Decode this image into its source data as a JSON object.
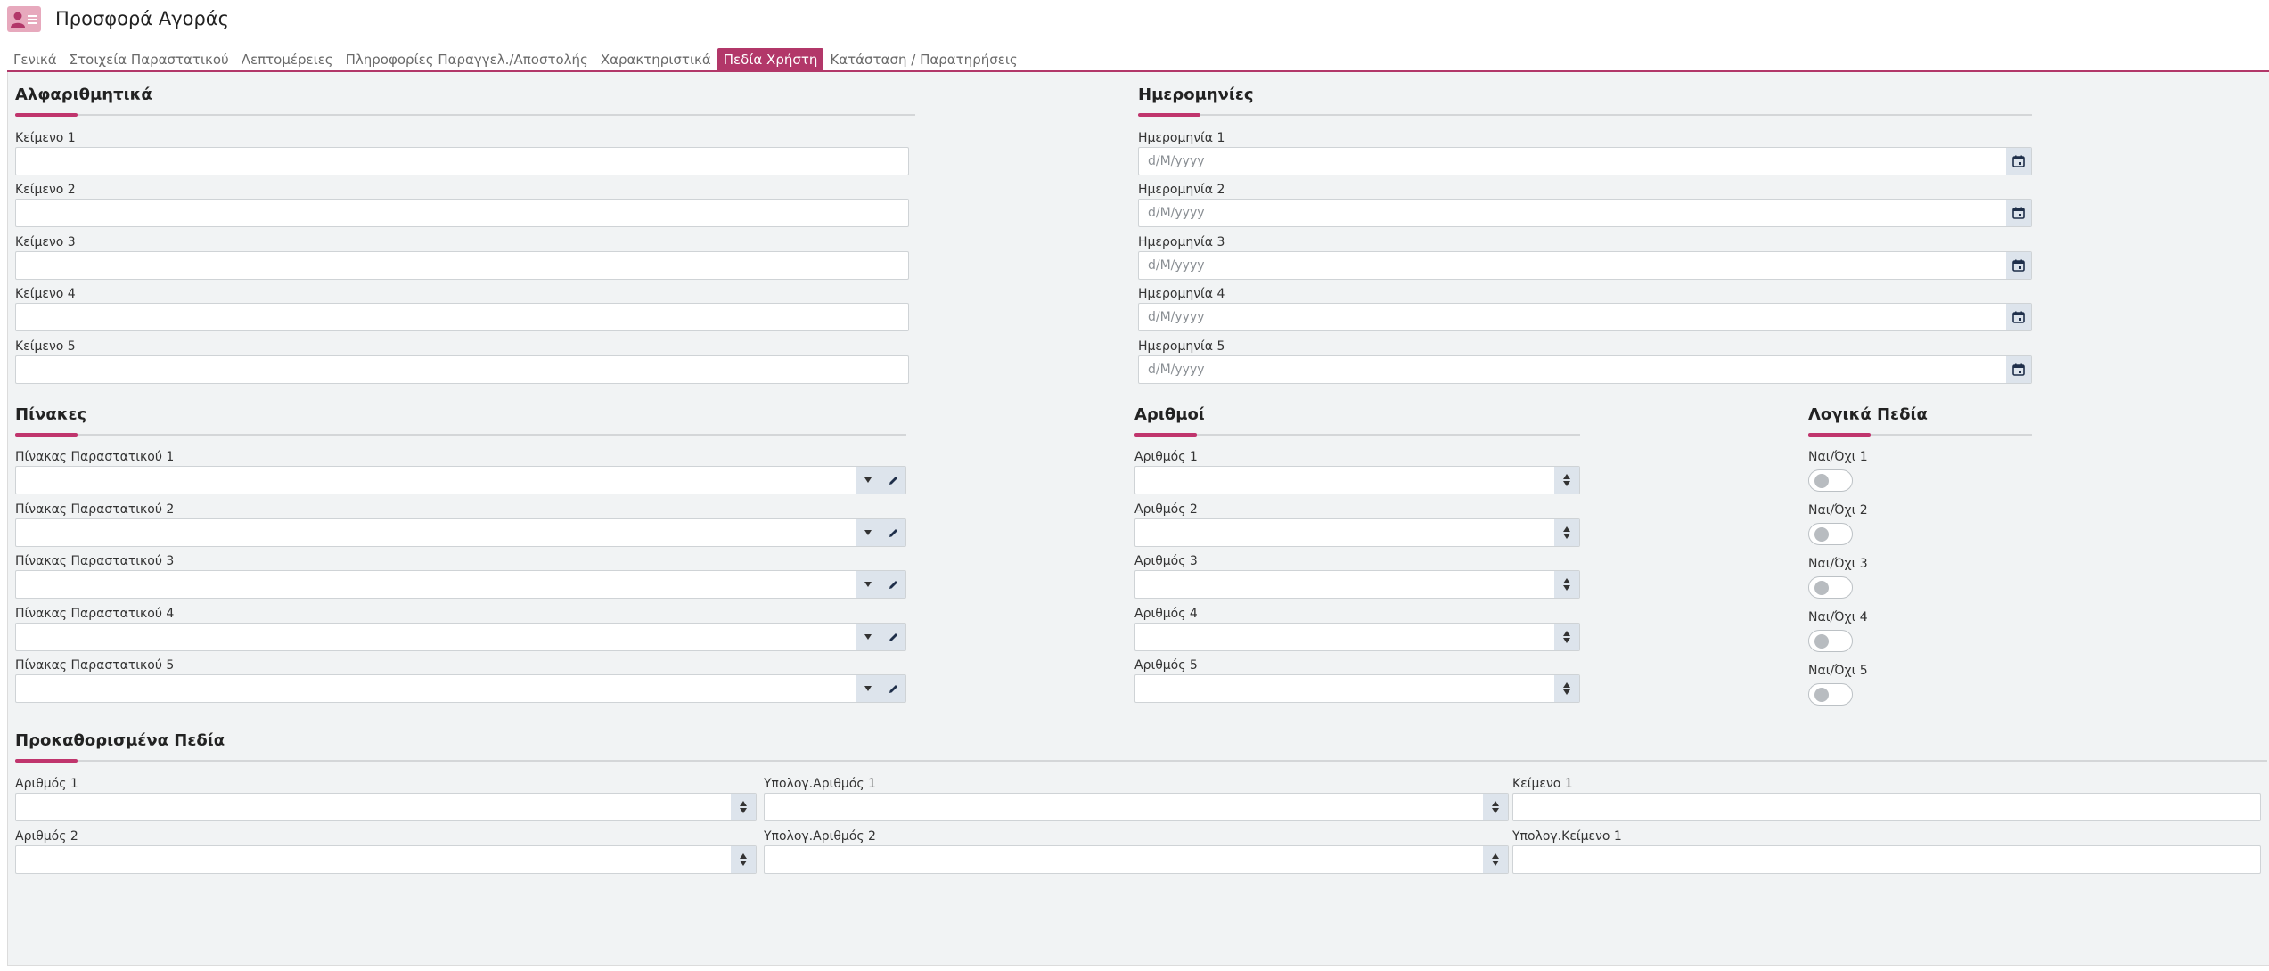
{
  "header": {
    "title": "Προσφορά Αγοράς",
    "icon": "user-card-icon"
  },
  "tabs": [
    {
      "label": "Γενικά"
    },
    {
      "label": "Στοιχεία Παραστατικού"
    },
    {
      "label": "Λεπτομέρειες"
    },
    {
      "label": "Πληροφορίες Παραγγελ./Αποστολής"
    },
    {
      "label": "Χαρακτηριστικά"
    },
    {
      "label": "Πεδία Χρήστη"
    },
    {
      "label": "Κατάσταση / Παρατηρήσεις"
    }
  ],
  "active_tab": "Πεδία Χρήστη",
  "accent_color": "#b23769",
  "alpha": {
    "title": "Αλφαριθμητικά",
    "fields": [
      {
        "label": "Κείμενο 1",
        "value": ""
      },
      {
        "label": "Κείμενο 2",
        "value": ""
      },
      {
        "label": "Κείμενο 3",
        "value": ""
      },
      {
        "label": "Κείμενο 4",
        "value": ""
      },
      {
        "label": "Κείμενο 5",
        "value": ""
      }
    ]
  },
  "dates": {
    "title": "Ημερομηνίες",
    "fields": [
      {
        "label": "Ημερομηνία 1",
        "placeholder": "d/M/yyyy",
        "icon": "calendar-icon"
      },
      {
        "label": "Ημερομηνία 2",
        "placeholder": "d/M/yyyy",
        "icon": "calendar-icon"
      },
      {
        "label": "Ημερομηνία 3",
        "placeholder": "d/M/yyyy",
        "icon": "calendar-icon"
      },
      {
        "label": "Ημερομηνία 4",
        "placeholder": "d/M/yyyy",
        "icon": "calendar-icon"
      },
      {
        "label": "Ημερομηνία 5",
        "placeholder": "d/M/yyyy",
        "icon": "calendar-icon"
      }
    ]
  },
  "tables": {
    "title": "Πίνακες",
    "fields": [
      {
        "label": "Πίνακας Παραστατικού 1",
        "value": ""
      },
      {
        "label": "Πίνακας Παραστατικού 2",
        "value": ""
      },
      {
        "label": "Πίνακας Παραστατικού 3",
        "value": ""
      },
      {
        "label": "Πίνακας Παραστατικού 4",
        "value": ""
      },
      {
        "label": "Πίνακας Παραστατικού 5",
        "value": ""
      }
    ]
  },
  "numbers": {
    "title": "Αριθμοί",
    "fields": [
      {
        "label": "Αριθμός 1",
        "value": ""
      },
      {
        "label": "Αριθμός 2",
        "value": ""
      },
      {
        "label": "Αριθμός 3",
        "value": ""
      },
      {
        "label": "Αριθμός 4",
        "value": ""
      },
      {
        "label": "Αριθμός 5",
        "value": ""
      }
    ]
  },
  "logic": {
    "title": "Λογικά Πεδία",
    "fields": [
      {
        "label": "Ναι/Όχι 1",
        "checked": false
      },
      {
        "label": "Ναι/Όχι 2",
        "checked": false
      },
      {
        "label": "Ναι/Όχι 3",
        "checked": false
      },
      {
        "label": "Ναι/Όχι 4",
        "checked": false
      },
      {
        "label": "Ναι/Όχι 5",
        "checked": false
      }
    ]
  },
  "predefined": {
    "title": "Προκαθορισμένα Πεδία",
    "fields": [
      {
        "label": "Αριθμός 1",
        "value": "",
        "kind": "number"
      },
      {
        "label": "Υπολογ.Αριθμός 1",
        "value": "",
        "kind": "number"
      },
      {
        "label": "Κείμενο 1",
        "value": "",
        "kind": "text"
      },
      {
        "label": "Αριθμός 2",
        "value": "",
        "kind": "number"
      },
      {
        "label": "Υπολογ.Αριθμός 2",
        "value": "",
        "kind": "number"
      },
      {
        "label": "Υπολογ.Κείμενο 1",
        "value": "",
        "kind": "text"
      }
    ]
  }
}
